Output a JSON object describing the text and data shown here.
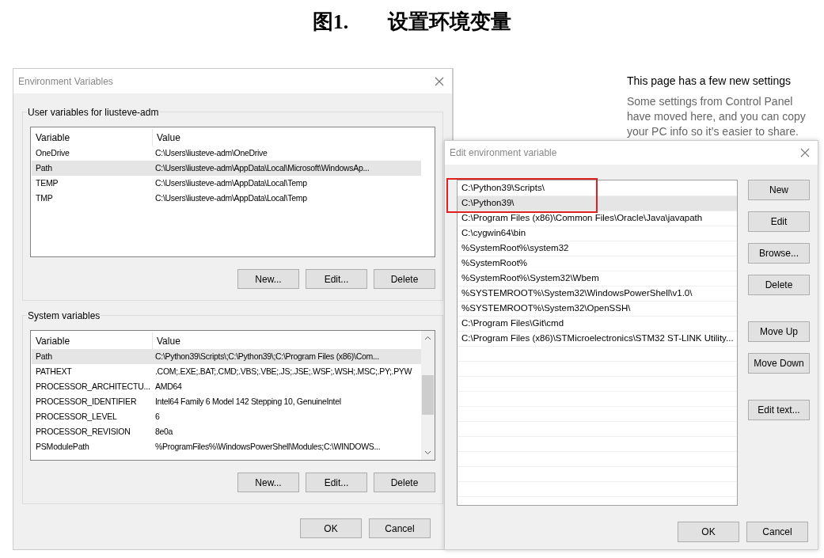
{
  "caption": {
    "figure_label": "图1.",
    "title": "设置环境变量"
  },
  "env_dialog": {
    "title": "Environment Variables",
    "user_group": {
      "label": "User variables for liusteve-adm",
      "columns": [
        "Variable",
        "Value"
      ],
      "rows": [
        {
          "variable": "OneDrive",
          "value": "C:\\Users\\liusteve-adm\\OneDrive",
          "selected": false
        },
        {
          "variable": "Path",
          "value": "C:\\Users\\liusteve-adm\\AppData\\Local\\Microsoft\\WindowsAp...",
          "selected": true
        },
        {
          "variable": "TEMP",
          "value": "C:\\Users\\liusteve-adm\\AppData\\Local\\Temp",
          "selected": false
        },
        {
          "variable": "TMP",
          "value": "C:\\Users\\liusteve-adm\\AppData\\Local\\Temp",
          "selected": false
        }
      ],
      "buttons": [
        "New...",
        "Edit...",
        "Delete"
      ]
    },
    "system_group": {
      "label": "System variables",
      "columns": [
        "Variable",
        "Value"
      ],
      "rows": [
        {
          "variable": "Path",
          "value": "C:\\Python39\\Scripts\\;C:\\Python39\\;C:\\Program Files (x86)\\Com...",
          "selected": true
        },
        {
          "variable": "PATHEXT",
          "value": ".COM;.EXE;.BAT;.CMD;.VBS;.VBE;.JS;.JSE;.WSF;.WSH;.MSC;.PY;.PYW",
          "selected": false
        },
        {
          "variable": "PROCESSOR_ARCHITECTU...",
          "value": "AMD64",
          "selected": false
        },
        {
          "variable": "PROCESSOR_IDENTIFIER",
          "value": "Intel64 Family 6 Model 142 Stepping 10, GenuineIntel",
          "selected": false
        },
        {
          "variable": "PROCESSOR_LEVEL",
          "value": "6",
          "selected": false
        },
        {
          "variable": "PROCESSOR_REVISION",
          "value": "8e0a",
          "selected": false
        },
        {
          "variable": "PSModulePath",
          "value": "%ProgramFiles%\\WindowsPowerShell\\Modules;C:\\WINDOWS...",
          "selected": false
        }
      ],
      "buttons": [
        "New...",
        "Edit...",
        "Delete"
      ]
    },
    "buttons": [
      "OK",
      "Cancel"
    ]
  },
  "settings_panel": {
    "heading": "This page has a few new settings",
    "text": "Some settings from Control Panel have moved here, and you can copy your PC info so it’s easier to share."
  },
  "edit_dialog": {
    "title": "Edit environment variable",
    "entries": [
      {
        "text": "C:\\Python39\\Scripts\\",
        "selected": false,
        "highlighted": true
      },
      {
        "text": "C:\\Python39\\",
        "selected": true,
        "highlighted": true
      },
      {
        "text": "C:\\Program Files (x86)\\Common Files\\Oracle\\Java\\javapath",
        "selected": false,
        "highlighted": false
      },
      {
        "text": "C:\\cygwin64\\bin",
        "selected": false,
        "highlighted": false
      },
      {
        "text": "%SystemRoot%\\system32",
        "selected": false,
        "highlighted": false
      },
      {
        "text": "%SystemRoot%",
        "selected": false,
        "highlighted": false
      },
      {
        "text": "%SystemRoot%\\System32\\Wbem",
        "selected": false,
        "highlighted": false
      },
      {
        "text": "%SYSTEMROOT%\\System32\\WindowsPowerShell\\v1.0\\",
        "selected": false,
        "highlighted": false
      },
      {
        "text": "%SYSTEMROOT%\\System32\\OpenSSH\\",
        "selected": false,
        "highlighted": false
      },
      {
        "text": "C:\\Program Files\\Git\\cmd",
        "selected": false,
        "highlighted": false
      },
      {
        "text": "C:\\Program Files (x86)\\STMicroelectronics\\STM32 ST-LINK Utility...",
        "selected": false,
        "highlighted": false
      }
    ],
    "side_button_groups": [
      [
        "New",
        "Edit",
        "Browse...",
        "Delete"
      ],
      [
        "Move Up",
        "Move Down"
      ],
      [
        "Edit text..."
      ]
    ],
    "buttons": [
      "OK",
      "Cancel"
    ]
  }
}
